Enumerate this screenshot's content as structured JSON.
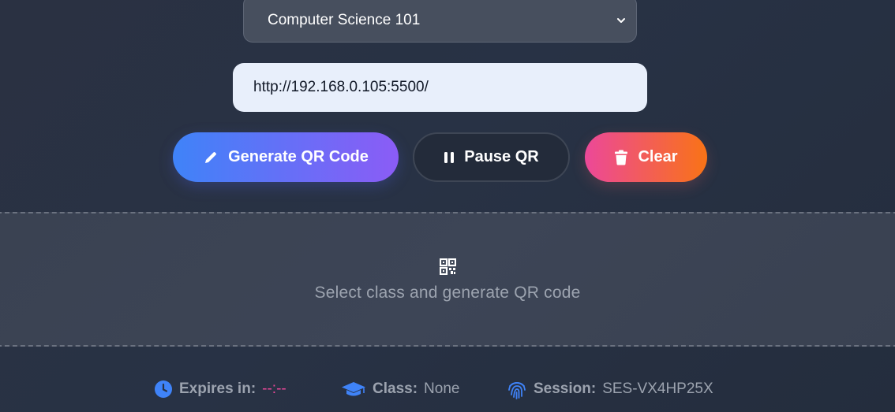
{
  "class_select": {
    "selected": "Computer Science 101",
    "icon": "chevron-down-icon"
  },
  "url_input": {
    "value": "http://192.168.0.105:5500/"
  },
  "buttons": {
    "generate": {
      "label": "Generate QR Code",
      "icon": "pencil-icon"
    },
    "pause": {
      "label": "Pause QR",
      "icon": "pause-icon"
    },
    "clear": {
      "label": "Clear",
      "icon": "trash-icon"
    }
  },
  "qr_area": {
    "icon": "qrcode-icon",
    "placeholder": "Select class and generate QR code"
  },
  "status": {
    "expires": {
      "label": "Expires in:",
      "value": "--:--",
      "icon": "clock-icon"
    },
    "class": {
      "label": "Class:",
      "value": "None",
      "icon": "graduation-cap-icon"
    },
    "session": {
      "label": "Session:",
      "value": "SES-VX4HP25X",
      "icon": "fingerprint-icon"
    }
  },
  "colors": {
    "accent_blue": "#3f83f8",
    "accent_purple": "#8b5cf6",
    "accent_pink": "#ec4899",
    "accent_orange": "#f97316",
    "background": "#283245"
  }
}
